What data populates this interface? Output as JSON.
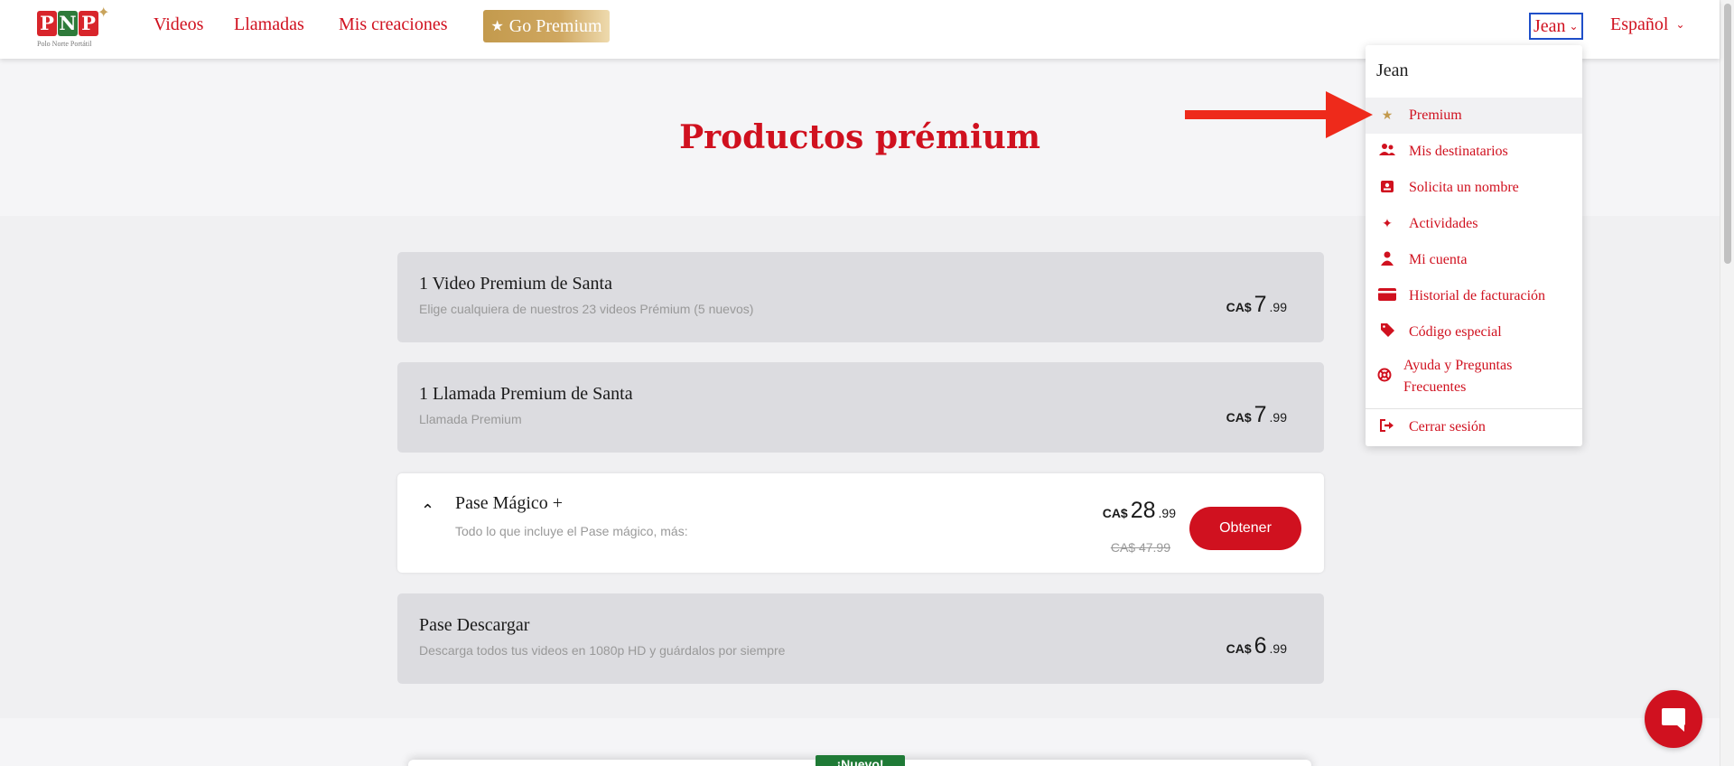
{
  "brand": {
    "letters": [
      "P",
      "N",
      "P"
    ],
    "tagline": "Polo Norte Portátil"
  },
  "nav": {
    "links": [
      "Videos",
      "Llamadas",
      "Mis creaciones"
    ],
    "premium_label": "Go Premium",
    "user": "Jean",
    "language": "Español"
  },
  "hero": {
    "title": "Productos prémium"
  },
  "products": [
    {
      "title": "1 Video Premium de Santa",
      "subtitle": "Elige cualquiera de nuestros 23 videos Prémium (5 nuevos)",
      "currency": "CA$",
      "price_main": "7",
      "price_cents": ".99"
    },
    {
      "title": "1 Llamada Premium de Santa",
      "subtitle": "Llamada Premium",
      "currency": "CA$",
      "price_main": "7",
      "price_cents": ".99"
    },
    {
      "title": "Pase Mágico +",
      "subtitle": "Todo lo que incluye el Pase mágico, más:",
      "currency": "CA$",
      "price_main": "28",
      "price_cents": ".99",
      "old_price": "CA$ 47.99",
      "button": "Obtener"
    },
    {
      "title": "Pase Descargar",
      "subtitle": "Descarga todos tus videos en 1080p HD y guárdalos por siempre",
      "currency": "CA$",
      "price_main": "6",
      "price_cents": ".99"
    }
  ],
  "bottom_badge": "¡Nuevo!",
  "dropdown": {
    "header": "Jean",
    "items": [
      {
        "label": "Premium",
        "icon": "star-icon"
      },
      {
        "label": "Mis destinatarios",
        "icon": "users-icon"
      },
      {
        "label": "Solicita un nombre",
        "icon": "id-card-icon"
      },
      {
        "label": "Actividades",
        "icon": "stars-icon"
      },
      {
        "label": "Mi cuenta",
        "icon": "user-icon"
      },
      {
        "label": "Historial de facturación",
        "icon": "credit-card-icon"
      },
      {
        "label": "Código especial",
        "icon": "tag-icon"
      },
      {
        "label": "Ayuda y Preguntas Frecuentes",
        "icon": "lifebuoy-icon"
      },
      {
        "label": "Cerrar sesión",
        "icon": "sign-out-icon"
      }
    ]
  },
  "colors": {
    "primary_red": "#d0111f",
    "gold": "#c39a4d",
    "annotation_red": "#ee2a1b",
    "badge_green": "#1f7a36"
  }
}
